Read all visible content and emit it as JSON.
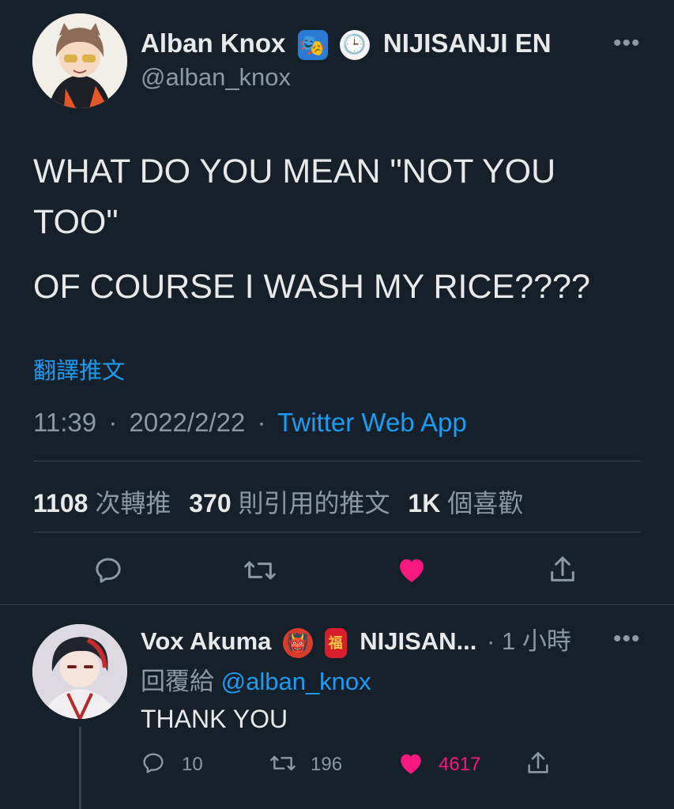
{
  "tweet": {
    "author": {
      "display_name": "Alban Knox",
      "emojis": [
        "performing-arts-emoji",
        "clock-emoji"
      ],
      "org": "NIJISANJI EN",
      "handle": "@alban_knox"
    },
    "text_line1": "WHAT DO YOU MEAN \"NOT YOU TOO\"",
    "text_line2": "OF COURSE I WASH MY RICE????",
    "translate_label": "翻譯推文",
    "time": "11:39",
    "date": "2022/2/22",
    "source": "Twitter Web App",
    "separator": "·",
    "stats": {
      "retweets_num": "1108",
      "retweets_label": "次轉推",
      "quotes_num": "370",
      "quotes_label": "則引用的推文",
      "likes_num": "1K",
      "likes_label": "個喜歡"
    }
  },
  "reply": {
    "author": {
      "display_name": "Vox Akuma",
      "emojis": [
        "ogre-emoji",
        "red-envelope-emoji"
      ],
      "org": "NIJISAN...",
      "time_ago": "· 1 小時"
    },
    "replying_to_label": "回覆給",
    "replying_to_handle": "@alban_knox",
    "text": "THANK YOU",
    "counts": {
      "replies": "10",
      "retweets": "196",
      "likes": "4617"
    }
  },
  "more_glyph": "•••",
  "colors": {
    "background": "#15202b",
    "text": "#e7e9ea",
    "secondary": "#8b98a5",
    "link": "#1d9bf0",
    "like": "#f91880",
    "divider": "#38444d"
  }
}
